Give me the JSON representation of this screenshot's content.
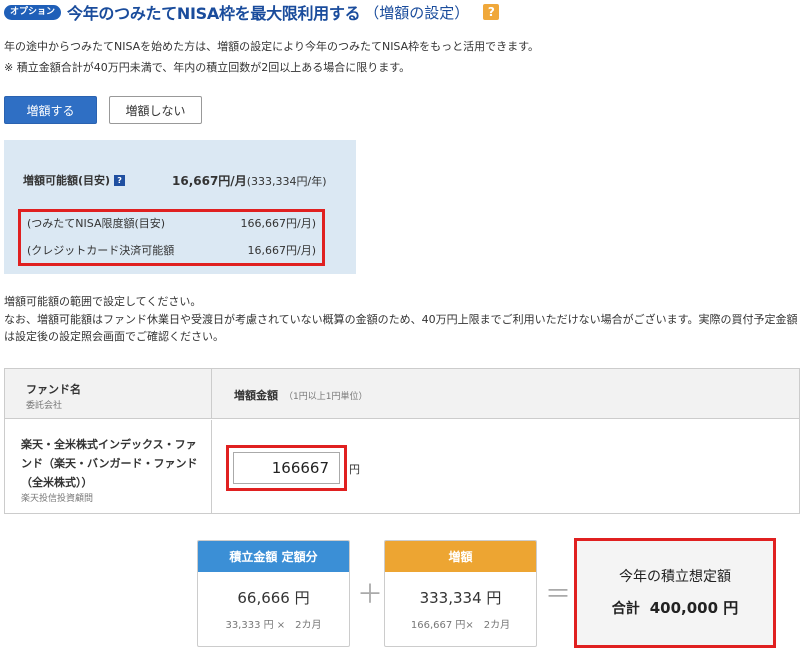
{
  "header": {
    "badge": "オプション",
    "title": "今年のつみたてNISA枠を最大限利用する",
    "subtitle": "（増額の設定）",
    "help_icon": "?"
  },
  "description": {
    "line1": "年の途中からつみたてNISAを始めた方は、増額の設定により今年のつみたてNISA枠をもっと活用できます。",
    "line2": "※ 積立金額合計が40万円未満で、年内の積立回数が2回以上ある場合に限ります。"
  },
  "buttons": {
    "increase": "増額する",
    "no_increase": "増額しない"
  },
  "info": {
    "label": "増額可能額(目安)",
    "mini_help": "?",
    "value": "16,667円/月",
    "value_sub": "(333,334円/年)",
    "limit_label": "(つみたてNISA限度額(目安)",
    "limit_value": "166,667円/月)",
    "credit_label": "(クレジットカード決済可能額",
    "credit_value": "16,667円/月)"
  },
  "notes": {
    "line1": "増額可能額の範囲で設定してください。",
    "line2": "なお、増額可能額はファンド休業日や受渡日が考慮されていない概算の金額のため、40万円上限までご利用いただけない場合がございます。実際の買付予定金額は設定後の設定照会画面でご確認ください。"
  },
  "table": {
    "col_fund": "ファンド名",
    "col_company": "委託会社",
    "col_amount": "増額金額",
    "col_amount_unit": "（1円以上1円単位）",
    "fund_name": "楽天・全米株式インデックス・ファンド（楽天・バンガード・ファンド（全米株式））",
    "fund_company": "楽天投信投資顧問",
    "amount_value": "166667",
    "amount_unit": "円"
  },
  "summary": {
    "card1": {
      "title": "積立金額 定額分",
      "main": "66,666 円",
      "sub": "33,333 円 ×　2カ月",
      "color": "#3b8fd6"
    },
    "plus": "＋",
    "card2": {
      "title": "増額",
      "main": "333,334 円",
      "sub": "166,667 円×　2カ月",
      "color": "#eda532"
    },
    "equals": "＝",
    "total_title": "今年の積立想定額",
    "total_label": "合計",
    "total_value": "400,000 円"
  },
  "colors": {
    "accent_blue": "#2f6fc4",
    "title_blue": "#1a4c9c",
    "highlight_red": "#e02020",
    "info_bg": "#dbe8f3"
  }
}
